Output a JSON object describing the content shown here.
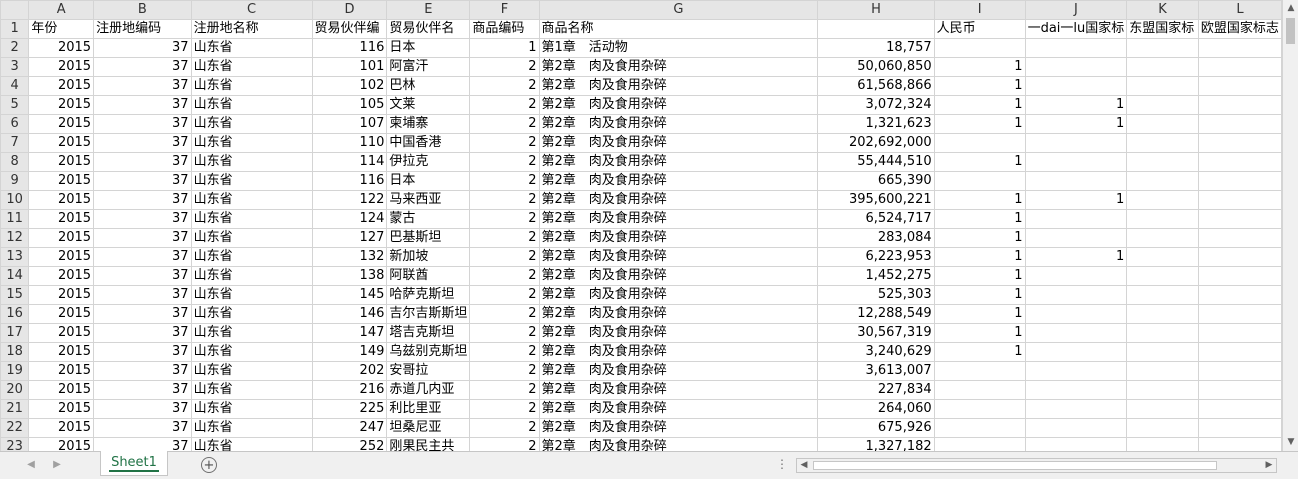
{
  "columns": [
    "A",
    "B",
    "C",
    "D",
    "E",
    "F",
    "G",
    "H",
    "I",
    "J",
    "K",
    "L"
  ],
  "header_row": [
    "年份",
    "注册地编码",
    "注册地名称",
    "贸易伙伴编",
    "贸易伙伴名",
    "商品编码",
    "商品名称",
    "",
    "人民币",
    "一dai一lu国家标",
    "东盟国家标",
    "欧盟国家标志"
  ],
  "rows": [
    {
      "n": "2",
      "year": "2015",
      "code": "37",
      "region": "山东省",
      "pcode": "116",
      "pname": "日本",
      "gcode": "1",
      "gname": "第1章　活动物",
      "rmb": "18,757",
      "bri": "",
      "asean": "",
      "eu": ""
    },
    {
      "n": "3",
      "year": "2015",
      "code": "37",
      "region": "山东省",
      "pcode": "101",
      "pname": "阿富汗",
      "gcode": "2",
      "gname": "第2章　肉及食用杂碎",
      "rmb": "50,060,850",
      "bri": "1",
      "asean": "",
      "eu": ""
    },
    {
      "n": "4",
      "year": "2015",
      "code": "37",
      "region": "山东省",
      "pcode": "102",
      "pname": "巴林",
      "gcode": "2",
      "gname": "第2章　肉及食用杂碎",
      "rmb": "61,568,866",
      "bri": "1",
      "asean": "",
      "eu": ""
    },
    {
      "n": "5",
      "year": "2015",
      "code": "37",
      "region": "山东省",
      "pcode": "105",
      "pname": "文莱",
      "gcode": "2",
      "gname": "第2章　肉及食用杂碎",
      "rmb": "3,072,324",
      "bri": "1",
      "asean": "1",
      "eu": ""
    },
    {
      "n": "6",
      "year": "2015",
      "code": "37",
      "region": "山东省",
      "pcode": "107",
      "pname": "柬埔寨",
      "gcode": "2",
      "gname": "第2章　肉及食用杂碎",
      "rmb": "1,321,623",
      "bri": "1",
      "asean": "1",
      "eu": ""
    },
    {
      "n": "7",
      "year": "2015",
      "code": "37",
      "region": "山东省",
      "pcode": "110",
      "pname": "中国香港",
      "gcode": "2",
      "gname": "第2章　肉及食用杂碎",
      "rmb": "202,692,000",
      "bri": "",
      "asean": "",
      "eu": ""
    },
    {
      "n": "8",
      "year": "2015",
      "code": "37",
      "region": "山东省",
      "pcode": "114",
      "pname": "伊拉克",
      "gcode": "2",
      "gname": "第2章　肉及食用杂碎",
      "rmb": "55,444,510",
      "bri": "1",
      "asean": "",
      "eu": ""
    },
    {
      "n": "9",
      "year": "2015",
      "code": "37",
      "region": "山东省",
      "pcode": "116",
      "pname": "日本",
      "gcode": "2",
      "gname": "第2章　肉及食用杂碎",
      "rmb": "665,390",
      "bri": "",
      "asean": "",
      "eu": ""
    },
    {
      "n": "10",
      "year": "2015",
      "code": "37",
      "region": "山东省",
      "pcode": "122",
      "pname": "马来西亚",
      "gcode": "2",
      "gname": "第2章　肉及食用杂碎",
      "rmb": "395,600,221",
      "bri": "1",
      "asean": "1",
      "eu": ""
    },
    {
      "n": "11",
      "year": "2015",
      "code": "37",
      "region": "山东省",
      "pcode": "124",
      "pname": "蒙古",
      "gcode": "2",
      "gname": "第2章　肉及食用杂碎",
      "rmb": "6,524,717",
      "bri": "1",
      "asean": "",
      "eu": ""
    },
    {
      "n": "12",
      "year": "2015",
      "code": "37",
      "region": "山东省",
      "pcode": "127",
      "pname": "巴基斯坦",
      "gcode": "2",
      "gname": "第2章　肉及食用杂碎",
      "rmb": "283,084",
      "bri": "1",
      "asean": "",
      "eu": ""
    },
    {
      "n": "13",
      "year": "2015",
      "code": "37",
      "region": "山东省",
      "pcode": "132",
      "pname": "新加坡",
      "gcode": "2",
      "gname": "第2章　肉及食用杂碎",
      "rmb": "6,223,953",
      "bri": "1",
      "asean": "1",
      "eu": ""
    },
    {
      "n": "14",
      "year": "2015",
      "code": "37",
      "region": "山东省",
      "pcode": "138",
      "pname": "阿联酋",
      "gcode": "2",
      "gname": "第2章　肉及食用杂碎",
      "rmb": "1,452,275",
      "bri": "1",
      "asean": "",
      "eu": ""
    },
    {
      "n": "15",
      "year": "2015",
      "code": "37",
      "region": "山东省",
      "pcode": "145",
      "pname": "哈萨克斯坦",
      "gcode": "2",
      "gname": "第2章　肉及食用杂碎",
      "rmb": "525,303",
      "bri": "1",
      "asean": "",
      "eu": ""
    },
    {
      "n": "16",
      "year": "2015",
      "code": "37",
      "region": "山东省",
      "pcode": "146",
      "pname": "吉尔吉斯斯坦",
      "gcode": "2",
      "gname": "第2章　肉及食用杂碎",
      "rmb": "12,288,549",
      "bri": "1",
      "asean": "",
      "eu": ""
    },
    {
      "n": "17",
      "year": "2015",
      "code": "37",
      "region": "山东省",
      "pcode": "147",
      "pname": "塔吉克斯坦",
      "gcode": "2",
      "gname": "第2章　肉及食用杂碎",
      "rmb": "30,567,319",
      "bri": "1",
      "asean": "",
      "eu": ""
    },
    {
      "n": "18",
      "year": "2015",
      "code": "37",
      "region": "山东省",
      "pcode": "149",
      "pname": "乌兹别克斯坦",
      "gcode": "2",
      "gname": "第2章　肉及食用杂碎",
      "rmb": "3,240,629",
      "bri": "1",
      "asean": "",
      "eu": ""
    },
    {
      "n": "19",
      "year": "2015",
      "code": "37",
      "region": "山东省",
      "pcode": "202",
      "pname": "安哥拉",
      "gcode": "2",
      "gname": "第2章　肉及食用杂碎",
      "rmb": "3,613,007",
      "bri": "",
      "asean": "",
      "eu": ""
    },
    {
      "n": "20",
      "year": "2015",
      "code": "37",
      "region": "山东省",
      "pcode": "216",
      "pname": "赤道几内亚",
      "gcode": "2",
      "gname": "第2章　肉及食用杂碎",
      "rmb": "227,834",
      "bri": "",
      "asean": "",
      "eu": ""
    },
    {
      "n": "21",
      "year": "2015",
      "code": "37",
      "region": "山东省",
      "pcode": "225",
      "pname": "利比里亚",
      "gcode": "2",
      "gname": "第2章　肉及食用杂碎",
      "rmb": "264,060",
      "bri": "",
      "asean": "",
      "eu": ""
    },
    {
      "n": "22",
      "year": "2015",
      "code": "37",
      "region": "山东省",
      "pcode": "247",
      "pname": "坦桑尼亚",
      "gcode": "2",
      "gname": "第2章　肉及食用杂碎",
      "rmb": "675,926",
      "bri": "",
      "asean": "",
      "eu": ""
    },
    {
      "n": "23",
      "year": "2015",
      "code": "37",
      "region": "山东省",
      "pcode": "252",
      "pname": "刚果民主共",
      "gcode": "2",
      "gname": "第2章　肉及食用杂碎",
      "rmb": "1,327,182",
      "bri": "",
      "asean": "",
      "eu": ""
    }
  ],
  "footer": {
    "sheet_tab": "Sheet1",
    "add_sheet": "⊕",
    "nav_prev": "◀",
    "nav_next": "▶",
    "dots": "⋮"
  },
  "colors": {
    "accent": "#217346",
    "header_bg": "#e6e6e6",
    "gridline": "#d4d4d4"
  }
}
